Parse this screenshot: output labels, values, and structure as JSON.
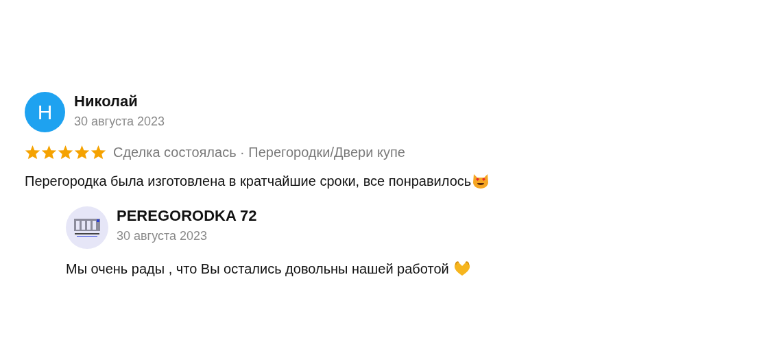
{
  "review": {
    "avatar_letter": "Н",
    "author": "Николай",
    "date": "30 августа 2023",
    "stars": 5,
    "meta": "Сделка состоялась · Перегородки/Двери купе",
    "text": "Перегородка была изготовлена в кратчайшие сроки, все понравилось"
  },
  "reply": {
    "author": "PEREGORODKA 72",
    "date": "30 августа 2023",
    "text": "Мы очень рады , что Вы остались довольны нашей работой"
  }
}
